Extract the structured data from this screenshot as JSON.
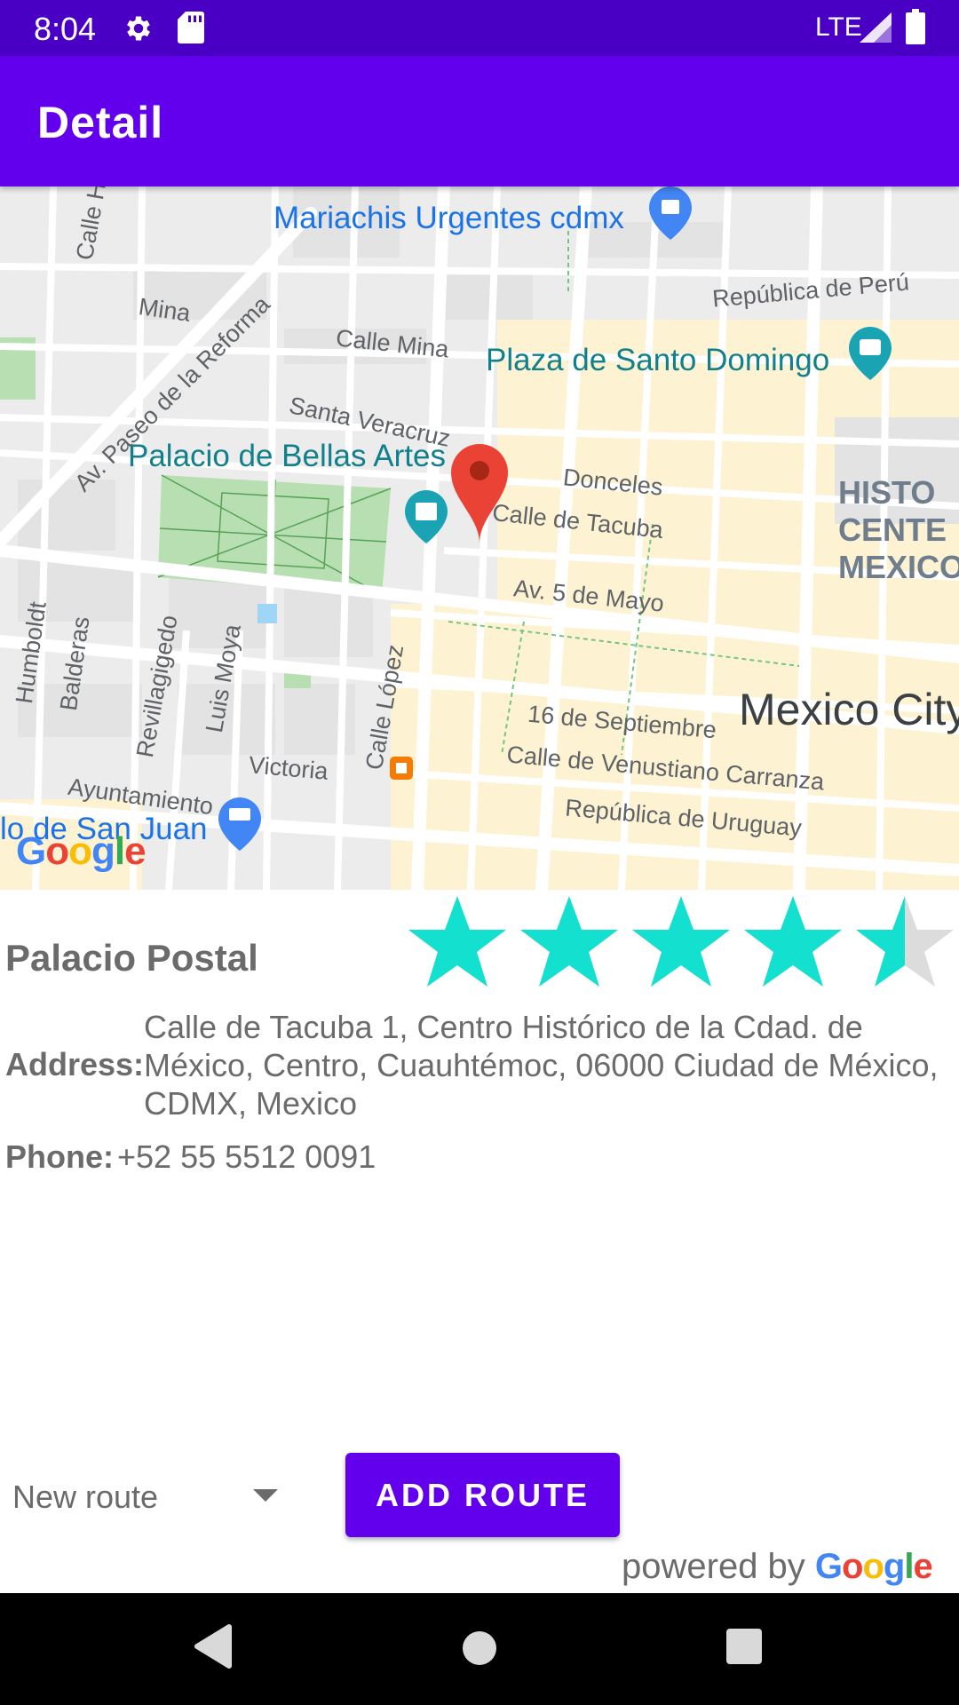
{
  "status_bar": {
    "time": "8:04",
    "network": "LTE",
    "icons": [
      "settings-gear-icon",
      "sd-card-icon",
      "cell-signal-icon",
      "battery-icon"
    ],
    "background": "#4a00c4"
  },
  "app_bar": {
    "title": "Detail",
    "background": "#6200ee"
  },
  "map": {
    "poi_labels": {
      "mariachis": "Mariachis Urgentes cdmx",
      "santo_domingo": "Plaza de Santo Domingo",
      "bellas_artes": "Palacio de Bellas Artes",
      "san_juan": "lo de San Juan"
    },
    "street_labels": {
      "calle_heroes": "Calle Heroes",
      "mina": "Mina",
      "calle_mina": "Calle Mina",
      "republica_peru": "República de Perú",
      "paseo_reforma": "Av. Paseo de la Reforma",
      "santa_veracruz": "Santa Veracruz",
      "donceles": "Donceles",
      "calle_tacuba": "Calle de Tacuba",
      "av_5_mayo": "Av. 5 de Mayo",
      "humboldt": "Humboldt",
      "balderas": "Balderas",
      "revillagigedo": "Revillagigedo",
      "luis_moya": "Luis Moya",
      "calle_lopez": "Calle López",
      "victoria": "Victoria",
      "ayuntamiento": "Ayuntamiento",
      "septiembre": "16 de Septiembre",
      "carranza": "Calle de Venustiano Carranza",
      "uruguay": "República de Uruguay"
    },
    "district": "HISTO\nCENTE\nMEXICO",
    "city": "Mexico City",
    "logo": "Google"
  },
  "place": {
    "name": "Palacio Postal",
    "rating": 4.5,
    "rating_max": 5,
    "star_color": "#14e0cf",
    "address_label": "Address:",
    "address": "Calle de Tacuba 1, Centro Histórico de la Cdad. de México, Centro, Cuauhtémoc, 06000 Ciudad de México, CDMX, Mexico",
    "phone_label": "Phone:",
    "phone": "+52 55 5512 0091"
  },
  "actions": {
    "route_select_value": "New route",
    "add_route_label": "ADD ROUTE",
    "powered_by": "powered by",
    "powered_logo": "Google"
  }
}
